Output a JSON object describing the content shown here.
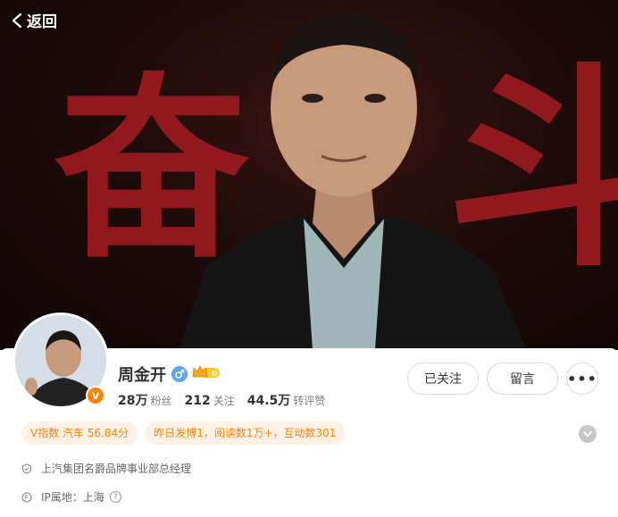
{
  "header": {
    "back_label": "返回"
  },
  "cover": {
    "char_left": "奋",
    "char_right": "斗"
  },
  "profile": {
    "name": "周金开",
    "verified_badge": "V",
    "gender_icon": "male-icon",
    "level_icon": "crown-icon",
    "stats": [
      {
        "value": "28万",
        "label": "粉丝"
      },
      {
        "value": "212",
        "label": "关注"
      },
      {
        "value": "44.5万",
        "label": "转评赞"
      }
    ]
  },
  "actions": {
    "follow_label": "已关注",
    "message_label": "留言",
    "more_label": "•••"
  },
  "tags": [
    "V指数 汽车 56.84分",
    "昨日发博1，阅读数1万+，互动数301"
  ],
  "details": {
    "title": "上汽集团名爵品牌事业部总经理",
    "ip_label": "IP属地：上海"
  },
  "colors": {
    "accent": "#ff8200",
    "tag_bg": "#fff1e6",
    "cover_red": "#9b1a1f"
  }
}
